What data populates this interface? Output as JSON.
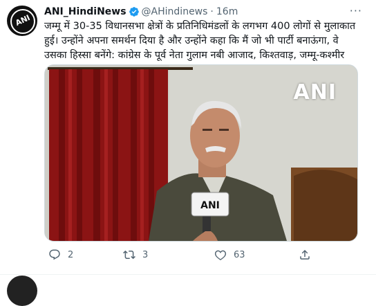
{
  "tweet": {
    "author_name": "ANI_HindiNews",
    "author_handle": "@AHindinews",
    "separator": "·",
    "time": "16m",
    "more_label": "···",
    "text": "जम्मू में 30-35 विधानसभा क्षेत्रों के प्रतिनिधिमंडलों के लगभग 400 लोगों से मुलाकात हुई। उन्होंने अपना समर्थन दिया है और उन्होंने कहा कि मैं जो भी पार्टी बनाऊंगा, वे उसका हिस्सा बनेंगे: कांग्रेस के पूर्व नेता गुलाम नबी आजाद, किश्तवाड़, जम्मू-कश्मीर",
    "avatar_text": "ANI",
    "media_watermark": "ANI",
    "mic_text": "ANI"
  },
  "actions": {
    "reply_count": "2",
    "retweet_count": "3",
    "like_count": "63",
    "reply_icon": "reply-icon",
    "retweet_icon": "retweet-icon",
    "like_icon": "heart-icon",
    "share_icon": "share-icon"
  },
  "colors": {
    "text": "#0f1419",
    "secondary": "#536471",
    "verified": "#1d9bf0",
    "border": "#cfd9de"
  }
}
